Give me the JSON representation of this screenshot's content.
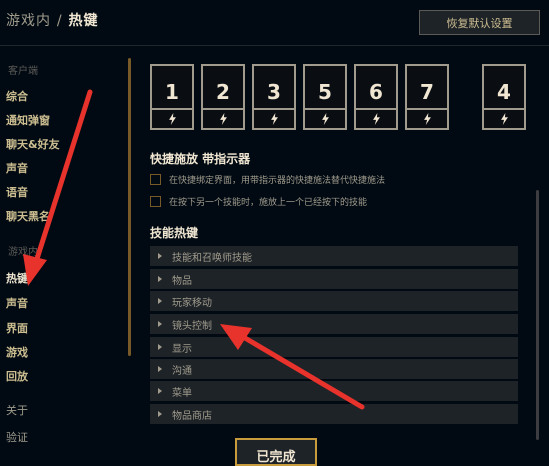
{
  "header": {
    "crumb_parent": "游戏内",
    "crumb_sep": "/",
    "crumb_current": "热键",
    "reset_label": "恢复默认设置"
  },
  "sidebar": {
    "section_client": "客户端",
    "client_items": [
      "综合",
      "通知弹窗",
      "聊天&好友",
      "声音",
      "语音",
      "聊天黑名"
    ],
    "section_ingame": "游戏内",
    "ingame_items": [
      "热键",
      "声音",
      "界面",
      "游戏",
      "回放"
    ],
    "active_item": "热键",
    "about_items": [
      "关于",
      "验证"
    ]
  },
  "keys": [
    "1",
    "2",
    "3",
    "5",
    "6",
    "7",
    "4"
  ],
  "quickcast": {
    "title": "快捷施放 带指示器",
    "options": [
      "在快捷绑定界面，用带指示器的快捷施法替代快捷施法",
      "在按下另一个技能时，施放上一个已经按下的技能"
    ]
  },
  "hotkeys": {
    "title": "技能热键",
    "categories": [
      "技能和召唤师技能",
      "物品",
      "玩家移动",
      "镜头控制",
      "显示",
      "沟通",
      "菜单",
      "物品商店"
    ]
  },
  "footer": {
    "done_label": "已完成"
  },
  "colors": {
    "background": "#010a13",
    "gold": "#cdbe91",
    "gold_bright": "#f0e6d2",
    "gold_border": "#c89b3c",
    "row_bg": "#1e2328",
    "annotation_arrow": "#e8322c"
  },
  "icons": {
    "key_slot": "lightning-bolt-icon",
    "category_row": "caret-right-icon",
    "option": "checkbox-icon"
  }
}
